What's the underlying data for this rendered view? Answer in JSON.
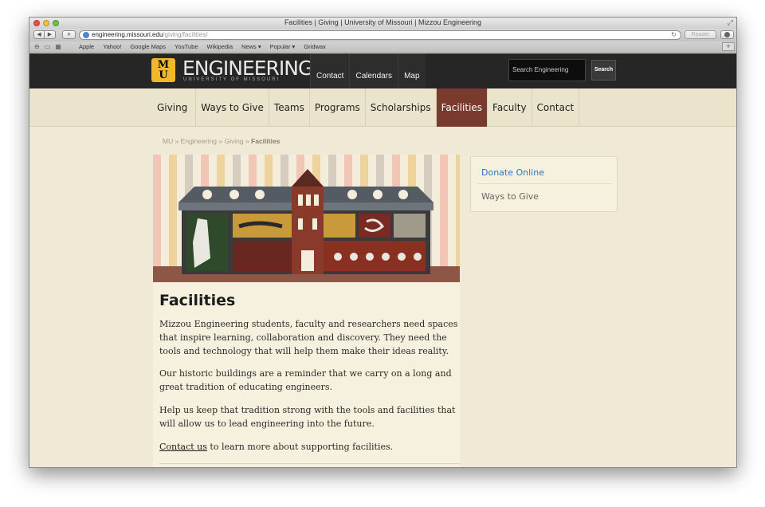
{
  "browser": {
    "window_title": "Facilities | Giving | University of Missouri | Mizzou Engineering",
    "url_host": "engineering.missouri.edu",
    "url_path": "/giving/facilities/",
    "reader_label": "Reader",
    "bookmarks": [
      "Apple",
      "Yahoo!",
      "Google Maps",
      "YouTube",
      "Wikipedia",
      "News ▾",
      "Popular ▾",
      "Gridwax"
    ]
  },
  "header": {
    "logo_text": "MU",
    "title": "ENGINEERING",
    "subtitle": "UNIVERSITY OF MISSOURI",
    "nav": [
      "Contact",
      "Calendars",
      "Map"
    ],
    "search_placeholder": "Search Engineering",
    "search_button": "Search"
  },
  "secondary_nav": {
    "items": [
      "Giving",
      "Ways to Give",
      "Teams",
      "Programs",
      "Scholarships",
      "Facilities",
      "Faculty",
      "Contact"
    ],
    "active": "Facilities"
  },
  "breadcrumb": {
    "trail": "MU » Engineering » Giving » ",
    "current": "Facilities"
  },
  "main": {
    "title": "Facilities",
    "paragraph1": "Mizzou Engineering students, faculty and researchers need spaces that inspire learning, collaboration and discovery. They need the tools and technology that will help them make their ideas reality.",
    "paragraph2": "Our historic buildings are a reminder that we carry on a long and great tradition of educating engineers.",
    "paragraph3": "Help us keep that tradition strong with the tools and facilities that will allow us to lead engineering into the future.",
    "contact_link": "Contact us",
    "contact_rest": " to learn more about supporting facilities."
  },
  "sidebar": {
    "donate": "Donate Online",
    "ways": "Ways to Give"
  },
  "colors": {
    "accent_active": "#7a3b2e",
    "link_blue": "#2e78b8",
    "mizzou_gold": "#f1b82d",
    "header_dark": "#262626"
  }
}
